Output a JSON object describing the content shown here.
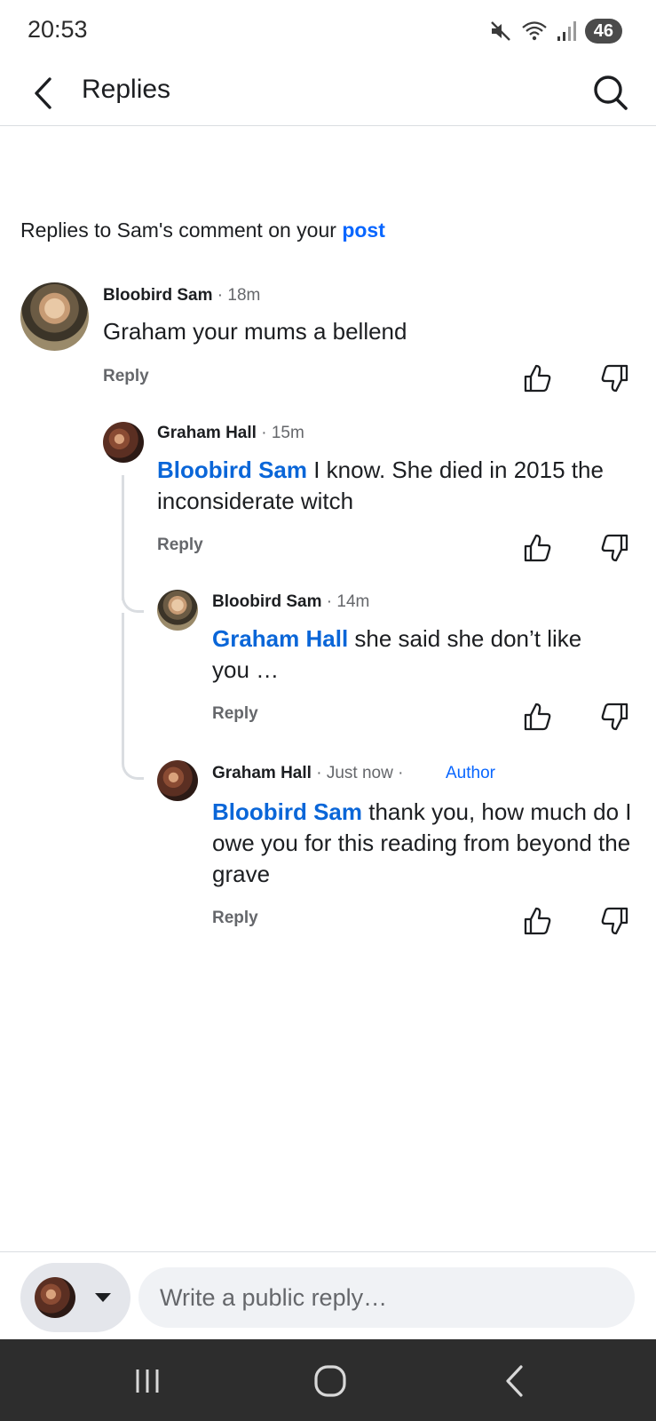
{
  "status_bar": {
    "time": "20:53",
    "battery": "46",
    "icons": [
      "mute-icon",
      "wifi-icon",
      "signal-icon",
      "battery-icon"
    ]
  },
  "header": {
    "title": "Replies",
    "back_icon": "chevron-left-icon",
    "search_icon": "search-icon"
  },
  "context": {
    "text": "Replies to Sam's comment on your ",
    "link": "post"
  },
  "comments": [
    {
      "author": "Bloobird Sam",
      "meta": " · 18m",
      "mention": "",
      "text": "Graham your mums a bellend",
      "reply_label": "Reply"
    },
    {
      "author": "Graham Hall",
      "meta": " · 15m",
      "mention": "Bloobird Sam",
      "text": " I know. She died in 2015 the inconsiderate witch",
      "reply_label": "Reply"
    },
    {
      "author": "Bloobird Sam",
      "meta": " · 14m",
      "mention": "Graham Hall",
      "text": " she said she don’t like you …",
      "reply_label": "Reply"
    },
    {
      "author": "Graham Hall",
      "meta": " · Just now ·",
      "badge": "Author",
      "mention": "Bloobird Sam",
      "text": " thank you, how much do I owe you for this reading from beyond the grave",
      "reply_label": "Reply"
    }
  ],
  "composer": {
    "placeholder": "Write a public reply…"
  },
  "colors": {
    "accent": "#0866ff",
    "mention": "#0a66d8",
    "secondary_text": "#65676b",
    "nav_bar": "#2d2d2d"
  }
}
